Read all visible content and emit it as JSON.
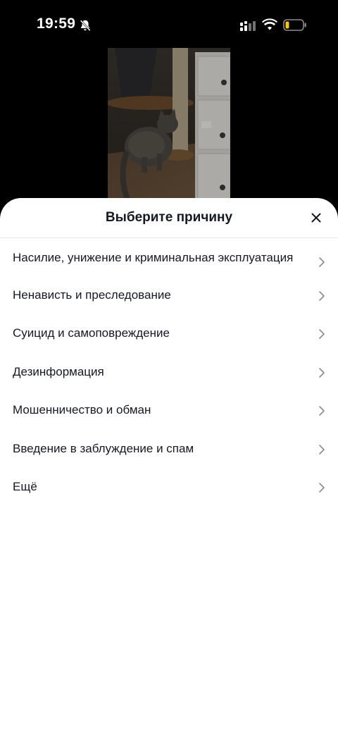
{
  "status_bar": {
    "time": "19:59",
    "icons": [
      "bell-slash-icon",
      "signal-icon",
      "wifi-icon",
      "battery-icon"
    ]
  },
  "video": {
    "description_icon": "cat-video-thumbnail"
  },
  "sheet": {
    "title": "Выберите причину",
    "close_icon": "close-icon",
    "reasons": [
      {
        "label": "Насилие, унижение и криминальная эксплуатация"
      },
      {
        "label": "Ненависть и преследование"
      },
      {
        "label": "Суицид и самоповреждение"
      },
      {
        "label": "Дезинформация"
      },
      {
        "label": "Мошенничество и обман"
      },
      {
        "label": "Введение в заблуждение и спам"
      },
      {
        "label": "Ещё"
      }
    ]
  },
  "colors": {
    "text_primary": "#161823",
    "chevron": "#8a8b91",
    "divider": "#e8e8e8",
    "battery_accent": "#f5c518",
    "background": "#000000",
    "sheet_background": "#ffffff"
  }
}
